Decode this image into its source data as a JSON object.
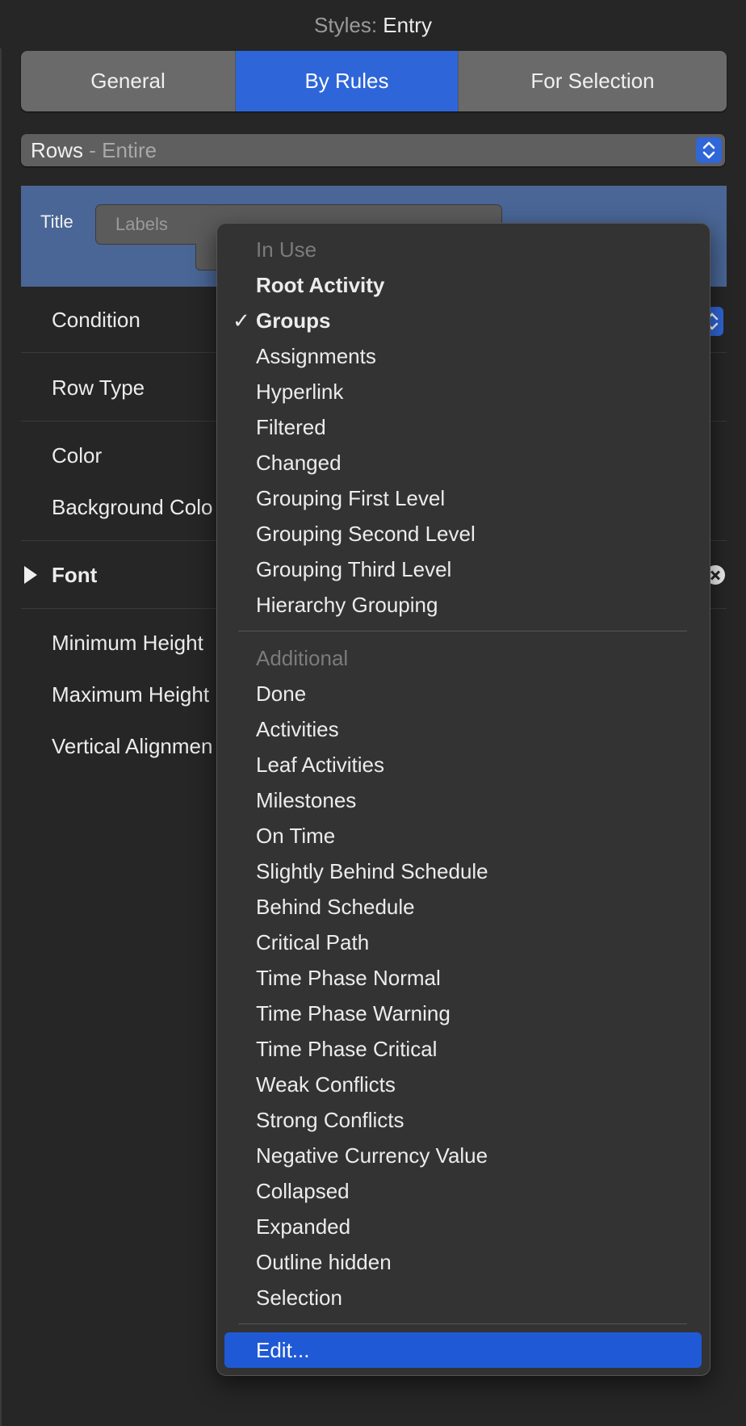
{
  "header": {
    "label": "Styles:",
    "value": "Entry"
  },
  "tabs": [
    {
      "label": "General",
      "selected": false
    },
    {
      "label": "By Rules",
      "selected": true
    },
    {
      "label": "For Selection",
      "selected": false
    }
  ],
  "scope_popup": {
    "main": "Rows",
    "separator": "-",
    "sub": "Entire"
  },
  "title_row": {
    "label": "Title",
    "placeholder": "Labels"
  },
  "rows": {
    "condition": "Condition",
    "row_type": "Row Type",
    "color": "Color",
    "background_color": "Background Colo",
    "font": "Font",
    "minimum_height": "Minimum Height",
    "maximum_height": "Maximum Height",
    "vertical_alignment": "Vertical Alignmen"
  },
  "menu": {
    "in_use_header": "In Use",
    "in_use_items": [
      "Root Activity",
      "Groups",
      "Assignments",
      "Hyperlink",
      "Filtered",
      "Changed",
      "Grouping First Level",
      "Grouping Second Level",
      "Grouping Third Level",
      "Hierarchy Grouping"
    ],
    "checked_item": "Groups",
    "check_mark": "✓",
    "additional_header": "Additional",
    "additional_items": [
      "Done",
      "Activities",
      "Leaf Activities",
      "Milestones",
      "On Time",
      "Slightly Behind Schedule",
      "Behind Schedule",
      "Critical Path",
      "Time Phase Normal",
      "Time Phase Warning",
      "Time Phase Critical",
      "Weak Conflicts",
      "Strong Conflicts",
      "Negative Currency Value",
      "Collapsed",
      "Expanded",
      "Outline hidden",
      "Selection"
    ],
    "edit_item": "Edit..."
  },
  "colors": {
    "accent": "#2e66d9",
    "menu_highlight": "#1f59d6",
    "background": "#262626",
    "title_area": "#4a6696"
  }
}
